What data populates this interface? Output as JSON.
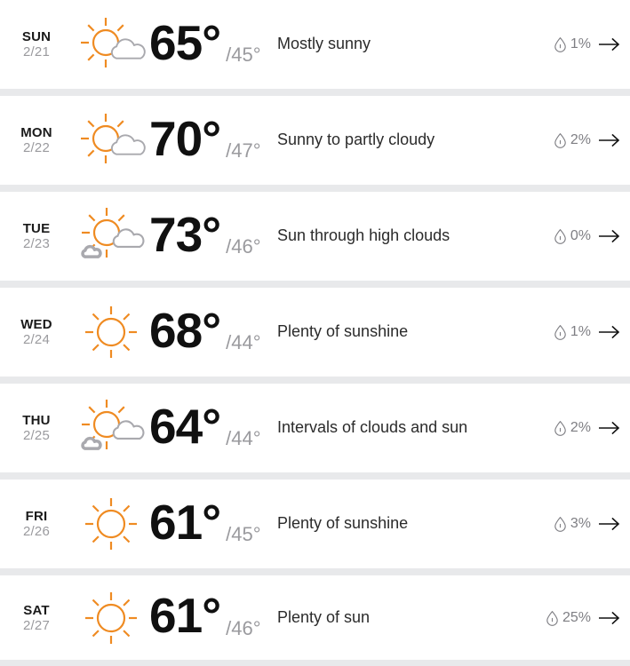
{
  "colors": {
    "sun": "#ef8b22",
    "cloud": "#a9a9ae",
    "row_background": "#ffffff",
    "page_background": "#e8e9eb",
    "high_temp": "#101010",
    "low_temp": "#9a9a9e",
    "day_label": "#1a1a1a",
    "date_label": "#9a9a9e",
    "description": "#2b2b2b",
    "precip_text": "#7e7e83",
    "arrow": "#111111"
  },
  "icons": {
    "precipitation": "water-drop-icon",
    "navigate": "arrow-right-icon",
    "sun": "sun-icon",
    "sun_cloud": "sun-behind-cloud-icon",
    "sun_clouds": "sun-behind-two-clouds-icon"
  },
  "forecast": {
    "days": [
      {
        "dow": "SUN",
        "date": "2/21",
        "icon": "sun-behind-cloud-icon",
        "high": "65°",
        "low": "/45°",
        "description": "Mostly sunny",
        "precip": "1%"
      },
      {
        "dow": "MON",
        "date": "2/22",
        "icon": "sun-behind-cloud-icon",
        "high": "70°",
        "low": "/47°",
        "description": "Sunny to partly cloudy",
        "precip": "2%"
      },
      {
        "dow": "TUE",
        "date": "2/23",
        "icon": "sun-behind-two-clouds-icon",
        "high": "73°",
        "low": "/46°",
        "description": "Sun through high clouds",
        "precip": "0%"
      },
      {
        "dow": "WED",
        "date": "2/24",
        "icon": "sun-icon",
        "high": "68°",
        "low": "/44°",
        "description": "Plenty of sunshine",
        "precip": "1%"
      },
      {
        "dow": "THU",
        "date": "2/25",
        "icon": "sun-behind-two-clouds-icon",
        "high": "64°",
        "low": "/44°",
        "description": "Intervals of clouds and sun",
        "precip": "2%"
      },
      {
        "dow": "FRI",
        "date": "2/26",
        "icon": "sun-icon",
        "high": "61°",
        "low": "/45°",
        "description": "Plenty of sunshine",
        "precip": "3%"
      },
      {
        "dow": "SAT",
        "date": "2/27",
        "icon": "sun-icon",
        "high": "61°",
        "low": "/46°",
        "description": "Plenty of sun",
        "precip": "25%"
      }
    ]
  }
}
